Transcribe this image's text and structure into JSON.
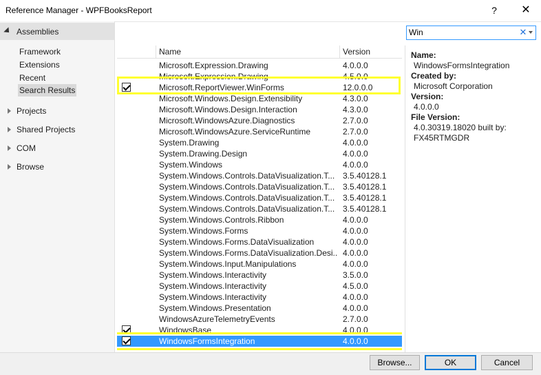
{
  "window": {
    "title": "Reference Manager - WPFBooksReport",
    "help_glyph": "?",
    "close_glyph": "✕"
  },
  "sidebar": {
    "header": "Assemblies",
    "sub_items": [
      "Framework",
      "Extensions",
      "Recent",
      "Search Results"
    ],
    "selected_sub_item": "Search Results",
    "groups": [
      "Projects",
      "Shared Projects",
      "COM",
      "Browse"
    ]
  },
  "search": {
    "value": "Win",
    "clear_glyph": "✕"
  },
  "columns": {
    "name": "Name",
    "version": "Version"
  },
  "rows": [
    {
      "name": "Microsoft.Expression.Drawing",
      "version": "4.0.0.0",
      "checked": false
    },
    {
      "name": "Microsoft.Expression.Drawing",
      "version": "4.5.0.0",
      "checked": false
    },
    {
      "name": "Microsoft.ReportViewer.WinForms",
      "version": "12.0.0.0",
      "checked": true
    },
    {
      "name": "Microsoft.Windows.Design.Extensibility",
      "version": "4.3.0.0",
      "checked": false
    },
    {
      "name": "Microsoft.Windows.Design.Interaction",
      "version": "4.3.0.0",
      "checked": false
    },
    {
      "name": "Microsoft.WindowsAzure.Diagnostics",
      "version": "2.7.0.0",
      "checked": false
    },
    {
      "name": "Microsoft.WindowsAzure.ServiceRuntime",
      "version": "2.7.0.0",
      "checked": false
    },
    {
      "name": "System.Drawing",
      "version": "4.0.0.0",
      "checked": false
    },
    {
      "name": "System.Drawing.Design",
      "version": "4.0.0.0",
      "checked": false
    },
    {
      "name": "System.Windows",
      "version": "4.0.0.0",
      "checked": false
    },
    {
      "name": "System.Windows.Controls.DataVisualization.T...",
      "version": "3.5.40128.1",
      "checked": false
    },
    {
      "name": "System.Windows.Controls.DataVisualization.T...",
      "version": "3.5.40128.1",
      "checked": false
    },
    {
      "name": "System.Windows.Controls.DataVisualization.T...",
      "version": "3.5.40128.1",
      "checked": false
    },
    {
      "name": "System.Windows.Controls.DataVisualization.T...",
      "version": "3.5.40128.1",
      "checked": false
    },
    {
      "name": "System.Windows.Controls.Ribbon",
      "version": "4.0.0.0",
      "checked": false
    },
    {
      "name": "System.Windows.Forms",
      "version": "4.0.0.0",
      "checked": false
    },
    {
      "name": "System.Windows.Forms.DataVisualization",
      "version": "4.0.0.0",
      "checked": false
    },
    {
      "name": "System.Windows.Forms.DataVisualization.Desi...",
      "version": "4.0.0.0",
      "checked": false
    },
    {
      "name": "System.Windows.Input.Manipulations",
      "version": "4.0.0.0",
      "checked": false
    },
    {
      "name": "System.Windows.Interactivity",
      "version": "3.5.0.0",
      "checked": false
    },
    {
      "name": "System.Windows.Interactivity",
      "version": "4.5.0.0",
      "checked": false
    },
    {
      "name": "System.Windows.Interactivity",
      "version": "4.0.0.0",
      "checked": false
    },
    {
      "name": "System.Windows.Presentation",
      "version": "4.0.0.0",
      "checked": false
    },
    {
      "name": "WindowsAzureTelemetryEvents",
      "version": "2.7.0.0",
      "checked": false
    },
    {
      "name": "WindowsBase",
      "version": "4.0.0.0",
      "checked": true
    },
    {
      "name": "WindowsFormsIntegration",
      "version": "4.0.0.0",
      "checked": true,
      "selected": true
    }
  ],
  "details": {
    "name_label": "Name:",
    "name_value": "WindowsFormsIntegration",
    "created_label": "Created by:",
    "created_value": "Microsoft Corporation",
    "version_label": "Version:",
    "version_value": "4.0.0.0",
    "file_version_label": "File Version:",
    "file_version_line1": "4.0.30319.18020 built by:",
    "file_version_line2": "FX45RTMGDR"
  },
  "footer": {
    "browse_label": "Browse...",
    "ok_label": "OK",
    "cancel_label": "Cancel"
  },
  "colors": {
    "selection": "#3399ff",
    "highlight": "#ffff30",
    "sidebar_bg": "#f5f5f5"
  }
}
